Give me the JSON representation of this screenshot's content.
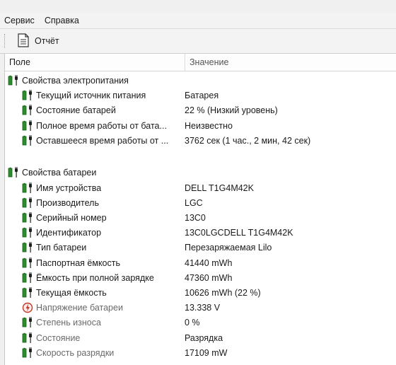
{
  "menu": {
    "items": [
      "Сервис",
      "Справка"
    ]
  },
  "toolbar": {
    "report_label": "Отчёт"
  },
  "columns": {
    "field": "Поле",
    "value": "Значение"
  },
  "groups": [
    {
      "title": "Свойства электропитания",
      "rows": [
        {
          "name": "Текущий источник питания",
          "value": "Батарея",
          "icon": "battery-plug-icon"
        },
        {
          "name": "Состояние батарей",
          "value": "22 % (Низкий уровень)",
          "icon": "battery-plug-icon"
        },
        {
          "name": "Полное время работы от бата...",
          "value": "Неизвестно",
          "icon": "battery-plug-icon"
        },
        {
          "name": "Оставшееся время работы от ...",
          "value": "3762 сек (1 час., 2 мин, 42 сек)",
          "icon": "battery-plug-icon"
        }
      ]
    },
    {
      "title": "Свойства батареи",
      "rows": [
        {
          "name": "Имя устройства",
          "value": "DELL T1G4M42K",
          "icon": "battery-plug-icon"
        },
        {
          "name": "Производитель",
          "value": "LGC",
          "icon": "battery-plug-icon"
        },
        {
          "name": "Серийный номер",
          "value": "13C0",
          "icon": "battery-plug-icon"
        },
        {
          "name": "Идентификатор",
          "value": "13C0LGCDELL T1G4M42K",
          "icon": "battery-plug-icon"
        },
        {
          "name": "Тип батареи",
          "value": "Перезаряжаемая Lilo",
          "icon": "battery-plug-icon"
        },
        {
          "name": "Паспортная ёмкость",
          "value": "41440 mWh",
          "icon": "battery-plug-icon"
        },
        {
          "name": "Ёмкость при полной зарядке",
          "value": "47360 mWh",
          "icon": "battery-plug-icon"
        },
        {
          "name": "Текущая ёмкость",
          "value": "10626 mWh  (22 %)",
          "icon": "battery-plug-icon"
        },
        {
          "name": "Напряжение батареи",
          "value": "13.338 V",
          "icon": "voltage-icon"
        },
        {
          "name": "Степень износа",
          "value": "0 %",
          "icon": "battery-plug-icon"
        },
        {
          "name": "Состояние",
          "value": "Разрядка",
          "icon": "battery-plug-icon"
        },
        {
          "name": "Скорость разрядки",
          "value": "17109 mW",
          "icon": "battery-plug-icon"
        }
      ]
    }
  ],
  "colors": {
    "battery_green": "#2e8b2e",
    "plug_dark": "#1f1f1f",
    "voltage_red": "#c0392b"
  }
}
